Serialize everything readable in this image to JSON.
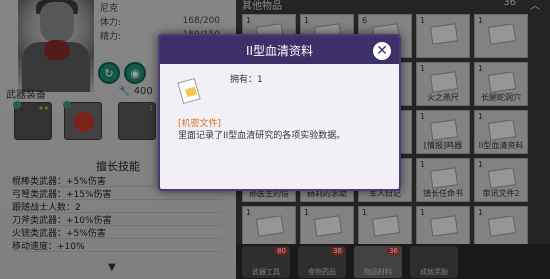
{
  "character": {
    "name": "尼克",
    "stats": [
      {
        "label": "体力:",
        "value": "168/200"
      },
      {
        "label": "精力:",
        "value": "150/150"
      }
    ]
  },
  "equipment": {
    "title": "武器装备",
    "score": "400",
    "slot_level": "1"
  },
  "specialty": {
    "title": "擅长技能",
    "rows": [
      "棍棒类武器：+5%伤害",
      "弓弩类武器：+15%伤害",
      "跟随战士人数：2",
      "刀斧类武器：+10%伤害",
      "火铳类武器：+5%伤害",
      "移动速度：+10%"
    ]
  },
  "inventory": {
    "title": "其他物品",
    "count": "36",
    "items": [
      {
        "qty": "1",
        "name": ""
      },
      {
        "qty": "1",
        "name": ""
      },
      {
        "qty": "6",
        "name": ""
      },
      {
        "qty": "1",
        "name": ""
      },
      {
        "qty": "1",
        "name": ""
      },
      {
        "qty": "1",
        "name": ""
      },
      {
        "qty": "1",
        "name": ""
      },
      {
        "qty": "1",
        "name": ""
      },
      {
        "qty": "1",
        "name": "火之燕尺"
      },
      {
        "qty": "1",
        "name": "长腿蛇洞穴"
      },
      {
        "qty": "1",
        "name": ""
      },
      {
        "qty": "1",
        "name": ""
      },
      {
        "qty": "1",
        "name": ""
      },
      {
        "qty": "1",
        "name": "[情报]鸣器"
      },
      {
        "qty": "1",
        "name": "II型血清资料"
      },
      {
        "qty": "1",
        "name": "郝医生的信"
      },
      {
        "qty": "1",
        "name": "赫莉的求助"
      },
      {
        "qty": "1",
        "name": "军人日记"
      },
      {
        "qty": "1",
        "name": "镇长任命书"
      },
      {
        "qty": "1",
        "name": "审讯文件2"
      },
      {
        "qty": "1",
        "name": ""
      },
      {
        "qty": "1",
        "name": ""
      },
      {
        "qty": "1",
        "name": ""
      },
      {
        "qty": "1",
        "name": ""
      },
      {
        "qty": "1",
        "name": ""
      }
    ]
  },
  "bottom_tabs": [
    {
      "label": "武器工具",
      "badge": "80"
    },
    {
      "label": "食物药品",
      "badge": "36"
    },
    {
      "label": "物品材料",
      "badge": "36"
    },
    {
      "label": "成就奖励",
      "badge": ""
    }
  ],
  "popup": {
    "title": "II型血清资料",
    "owned": "拥有：1",
    "category": "[机密文件]",
    "description": "里面记录了II型血清研究的各项实验数据。",
    "close_symbol": "✕"
  }
}
